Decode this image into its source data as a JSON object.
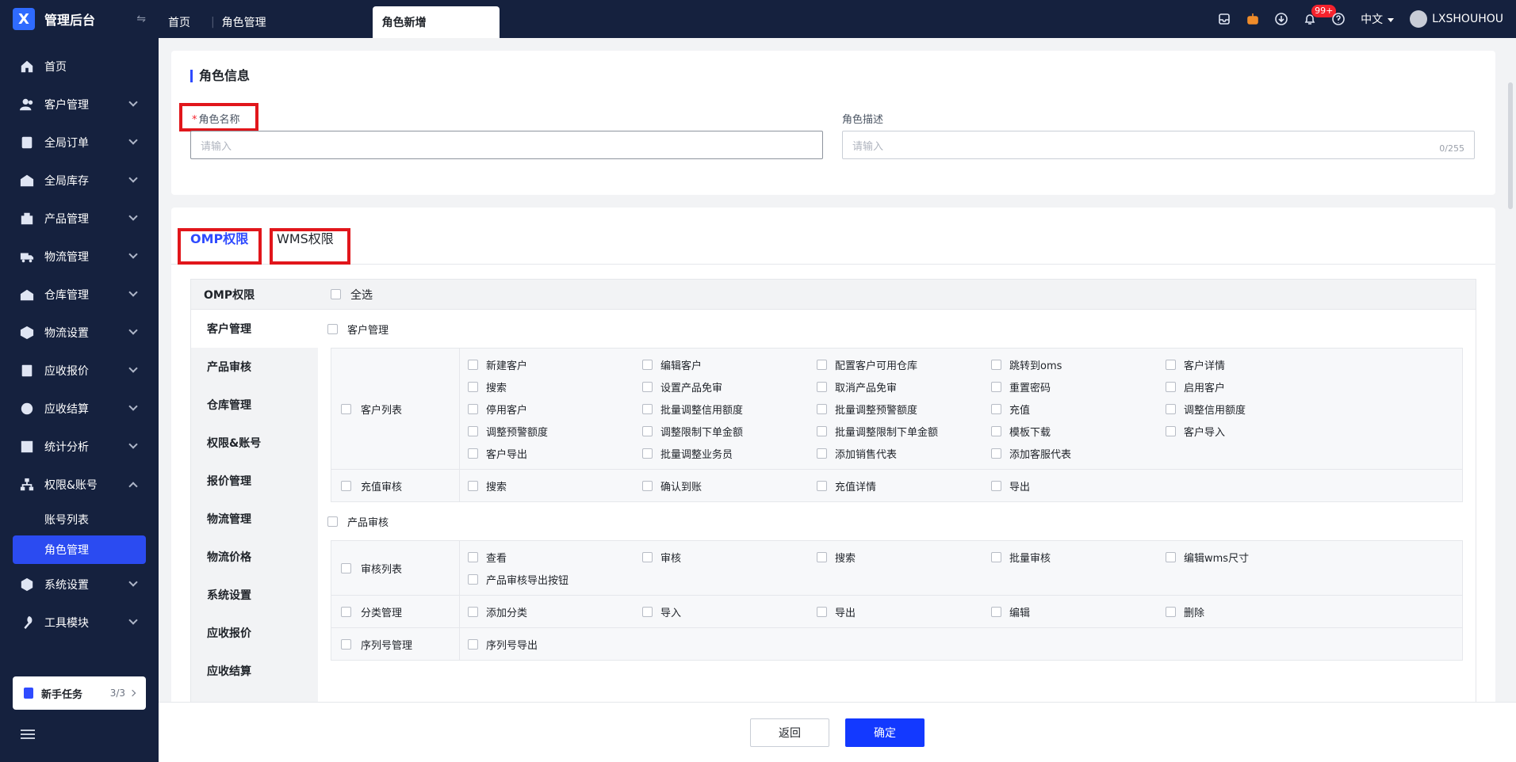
{
  "app": {
    "title": "管理后台",
    "logo_glyph": "X"
  },
  "tabs": [
    {
      "label": "首页"
    },
    {
      "label": "角色管理"
    },
    {
      "label": "角色新增"
    }
  ],
  "topbar": {
    "notif_badge": "99+",
    "language": "中文",
    "user": "LXSHOUHOU"
  },
  "sidebar": {
    "items": [
      {
        "label": "首页",
        "icon": "home-icon"
      },
      {
        "label": "客户管理",
        "icon": "users-icon"
      },
      {
        "label": "全局订单",
        "icon": "order-icon"
      },
      {
        "label": "全局库存",
        "icon": "warehouse-icon"
      },
      {
        "label": "产品管理",
        "icon": "product-icon"
      },
      {
        "label": "物流管理",
        "icon": "truck-icon"
      },
      {
        "label": "仓库管理",
        "icon": "warehouse2-icon"
      },
      {
        "label": "物流设置",
        "icon": "box-icon"
      },
      {
        "label": "应收报价",
        "icon": "quote-icon"
      },
      {
        "label": "应收结算",
        "icon": "money-icon"
      },
      {
        "label": "统计分析",
        "icon": "chart-icon"
      },
      {
        "label": "权限&账号",
        "icon": "org-icon"
      },
      {
        "label": "系统设置",
        "icon": "settings-icon"
      },
      {
        "label": "工具模块",
        "icon": "tool-icon"
      }
    ],
    "sub_items": [
      {
        "label": "账号列表"
      },
      {
        "label": "角色管理"
      }
    ],
    "newbie": {
      "label": "新手任务",
      "count": "3/3"
    }
  },
  "role_info": {
    "section_title": "角色信息",
    "name_label": "角色名称",
    "name_required": "*",
    "name_placeholder": "请输入",
    "desc_label": "角色描述",
    "desc_placeholder": "请输入",
    "desc_counter": "0/255"
  },
  "perm_tabs": [
    {
      "label": "OMP权限"
    },
    {
      "label": "WMS权限"
    }
  ],
  "perm": {
    "header": "OMP权限",
    "select_all": "全选",
    "modules": [
      {
        "label": "客户管理"
      },
      {
        "label": "产品审核"
      },
      {
        "label": "仓库管理"
      },
      {
        "label": "权限&账号"
      },
      {
        "label": "报价管理"
      },
      {
        "label": "物流管理"
      },
      {
        "label": "物流价格"
      },
      {
        "label": "系统设置"
      },
      {
        "label": "应收报价"
      },
      {
        "label": "应收结算"
      }
    ],
    "groups": [
      {
        "title": "客户管理",
        "rows": [
          {
            "label": "客户列表",
            "items": [
              "新建客户",
              "编辑客户",
              "配置客户可用仓库",
              "跳转到oms",
              "客户详情",
              "搜索",
              "设置产品免审",
              "取消产品免审",
              "重置密码",
              "启用客户",
              "停用客户",
              "批量调整信用额度",
              "批量调整预警额度",
              "充值",
              "调整信用额度",
              "调整预警额度",
              "调整限制下单金额",
              "批量调整限制下单金额",
              "模板下载",
              "客户导入",
              "客户导出",
              "批量调整业务员",
              "添加销售代表",
              "添加客服代表"
            ]
          },
          {
            "label": "充值审核",
            "items": [
              "搜索",
              "确认到账",
              "充值详情",
              "导出"
            ]
          }
        ]
      },
      {
        "title": "产品审核",
        "rows": [
          {
            "label": "审核列表",
            "items": [
              "查看",
              "审核",
              "搜索",
              "批量审核",
              "编辑wms尺寸",
              "产品审核导出按钮"
            ]
          },
          {
            "label": "分类管理",
            "items": [
              "添加分类",
              "导入",
              "导出",
              "编辑",
              "删除"
            ]
          },
          {
            "label": "序列号管理",
            "items": [
              "序列号导出"
            ]
          }
        ]
      }
    ]
  },
  "footer": {
    "back": "返回",
    "confirm": "确定"
  },
  "colors": {
    "sidebar_bg": "#15213e",
    "accent": "#2f4bff",
    "highlight_box": "#e1161b"
  }
}
